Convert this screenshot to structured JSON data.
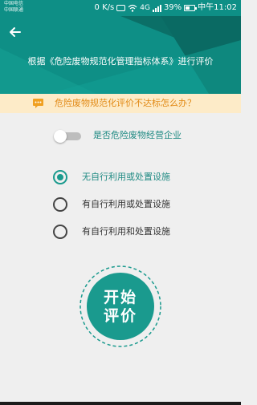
{
  "colors": {
    "teal_dark": "#0b6f67",
    "teal": "#0e8f86",
    "teal_light": "#14a397",
    "accent": "#1a9a8e",
    "notice_bg": "#fdebc8",
    "notice_text": "#e28a16",
    "background": "#efefef"
  },
  "status_bar": {
    "carrier_1": "中国电信",
    "carrier_2": "中国联通",
    "speed": "0 K/s",
    "network_small": "4G",
    "battery": "39%",
    "time": "中午11:02",
    "icons": [
      "wifi-icon",
      "signal-icon",
      "battery-icon",
      "eye-icon"
    ]
  },
  "header": {
    "back_icon": "arrow-left-icon",
    "title": "根据《危险废物规范化管理指标体系》进行评价"
  },
  "notice": {
    "icon": "chat-bubble-icon",
    "text": "危险废物规范化评价不达标怎么办？"
  },
  "toggle": {
    "label": "是否危险废物经营企业",
    "on": false
  },
  "options": [
    {
      "label": "无自行利用或处置设施",
      "selected": true
    },
    {
      "label": "有自行利用或处置设施",
      "selected": false
    },
    {
      "label": "有自行利用和处置设施",
      "selected": false
    }
  ],
  "start_button": {
    "line1": "开始",
    "line2": "评价"
  }
}
